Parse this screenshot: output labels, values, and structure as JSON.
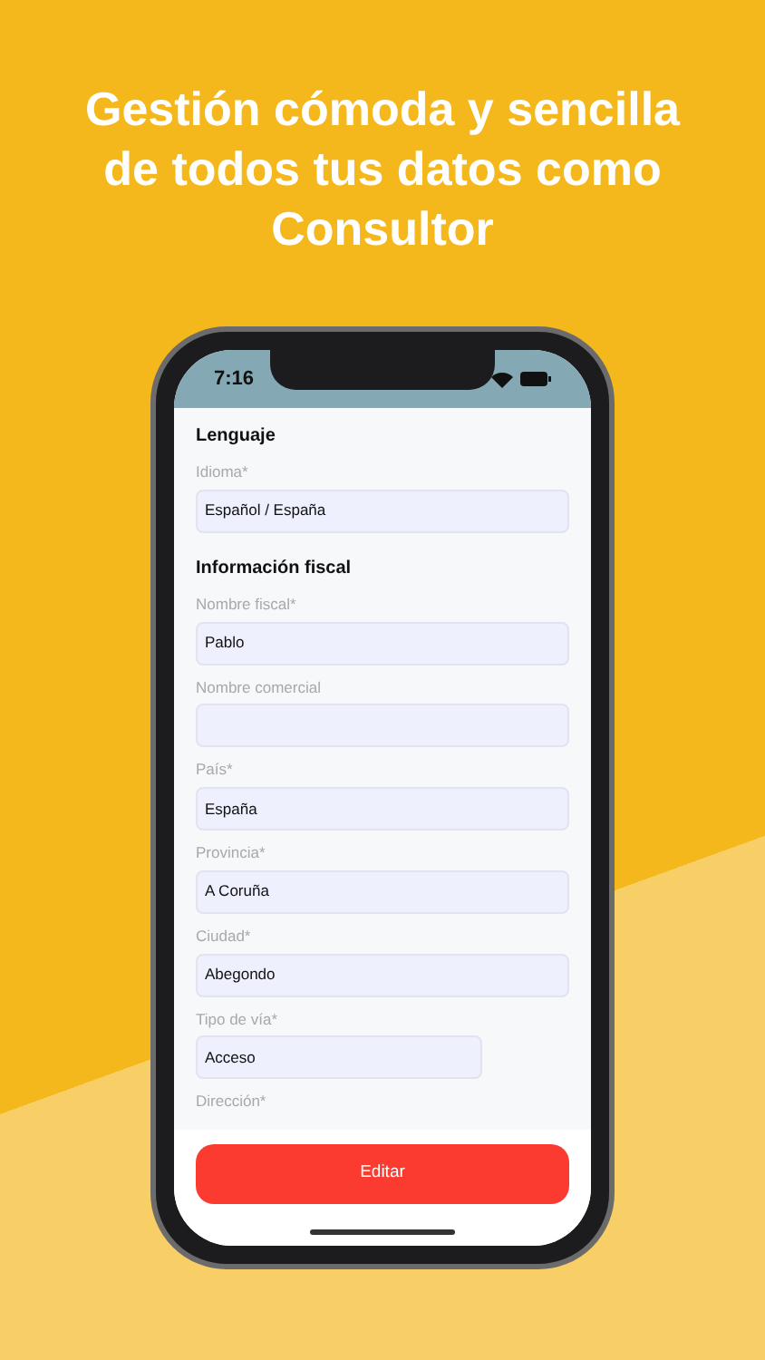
{
  "headline_lines": [
    "Gestión cómoda y sencilla",
    "de todos tus datos como",
    "Consultor"
  ],
  "status_bar": {
    "time": "7:16"
  },
  "sections": [
    {
      "title": "Lenguaje",
      "fields": [
        {
          "label": "Idioma*",
          "value": "Español / España",
          "kind": "full"
        }
      ]
    },
    {
      "title": "Información fiscal",
      "fields": [
        {
          "label": "Nombre fiscal*",
          "value": "Pablo",
          "kind": "full"
        },
        {
          "label": "Nombre comercial",
          "kind": "full"
        },
        {
          "label": "País*",
          "value": "España",
          "kind": "full"
        },
        {
          "label": "Provincia*",
          "value": "A Coruña",
          "kind": "full"
        },
        {
          "label": "Ciudad*",
          "value": "Abegondo",
          "kind": "full"
        },
        {
          "label": "Tipo de vía*",
          "value": "Acceso",
          "kind": "short"
        },
        {
          "label": "Dirección*",
          "kind": "cut"
        }
      ]
    }
  ],
  "action_button": "Editar"
}
